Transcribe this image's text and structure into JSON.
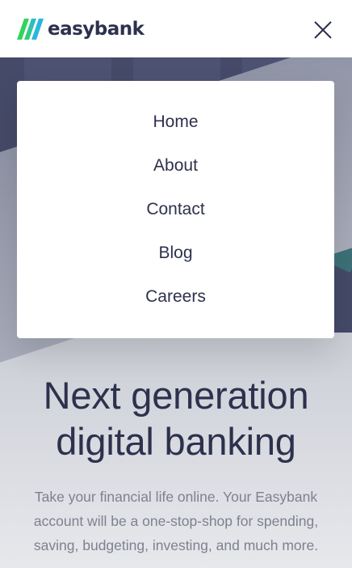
{
  "header": {
    "logo_text": "easybank",
    "logo_icon": "easybank-logo-mark",
    "close_icon": "close-icon"
  },
  "menu": {
    "items": [
      {
        "label": "Home"
      },
      {
        "label": "About"
      },
      {
        "label": "Contact"
      },
      {
        "label": "Blog"
      },
      {
        "label": "Careers"
      }
    ]
  },
  "hero": {
    "headline_line1": "Next generation",
    "headline_line2": "digital banking",
    "subtext_line1": "Take your financial life online. Your Easybank",
    "subtext_line2": "account will be a one-stop-shop for spending,",
    "subtext_line3": "saving, budgeting, investing, and much more."
  },
  "colors": {
    "dark_blue": "#2d314d",
    "grayish_blue": "#7e8190",
    "lime_green": "#31d35c",
    "bright_cyan": "#2bb7da"
  }
}
